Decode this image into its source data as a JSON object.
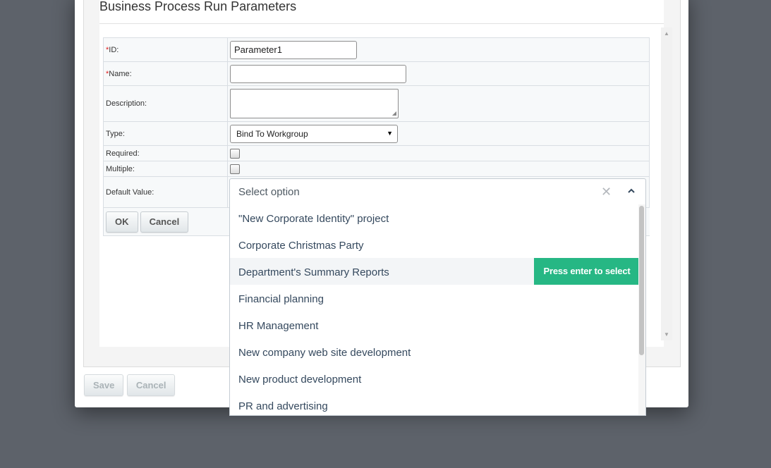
{
  "dialog": {
    "title": "Business Process Run Parameters",
    "fields": {
      "id": {
        "label": "ID:",
        "value": "Parameter1",
        "required_mark": "*"
      },
      "name": {
        "label": "Name:",
        "value": "",
        "required_mark": "*"
      },
      "description": {
        "label": "Description:",
        "value": ""
      },
      "type": {
        "label": "Type:",
        "value": "Bind To Workgroup"
      },
      "required": {
        "label": "Required:",
        "checked": false
      },
      "multiple": {
        "label": "Multiple:",
        "checked": false
      },
      "default_value": {
        "label": "Default Value:"
      }
    },
    "buttons": {
      "ok": "OK",
      "cancel": "Cancel"
    },
    "footer": {
      "save": "Save",
      "cancel": "Cancel"
    }
  },
  "multiselect": {
    "placeholder": "Select option",
    "clear_icon": "close-icon",
    "toggle_icon": "chevron-up-icon",
    "highlight_hint": "Press enter to select",
    "highlight_color": "#26b784",
    "options": [
      "\"New Corporate Identity\" project",
      "Corporate Christmas Party",
      "Department's Summary Reports",
      "Financial planning",
      "HR Management",
      "New company web site development",
      "New product development",
      "PR and advertising"
    ],
    "highlighted_index": 2
  }
}
